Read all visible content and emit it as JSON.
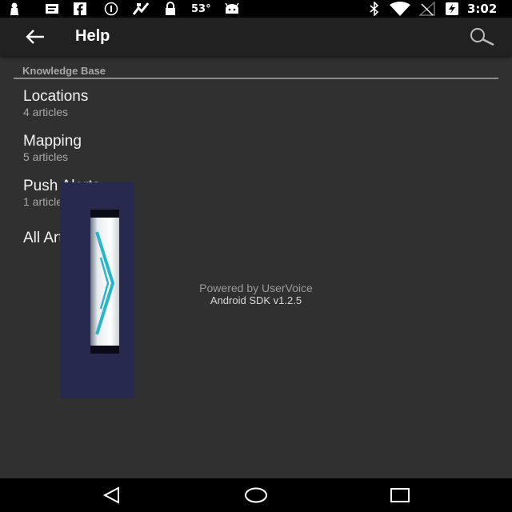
{
  "status_bar": {
    "temperature": "53°",
    "time": "3:02",
    "left_icons": [
      "person-icon",
      "message-icon",
      "facebook-icon",
      "info-icon",
      "satellite-icon",
      "lock-icon"
    ],
    "right_icons": [
      "bluetooth-icon",
      "wifi-icon",
      "signal-off-icon",
      "battery-charging-icon"
    ]
  },
  "app_bar": {
    "title": "Help",
    "back_icon": "arrow-back-icon",
    "search_icon": "search-icon"
  },
  "knowledge_base": {
    "header": "Knowledge Base",
    "topics": [
      {
        "title": "Locations",
        "subtitle": "4 articles"
      },
      {
        "title": "Mapping",
        "subtitle": "5 articles"
      },
      {
        "title": "Push Alerts",
        "subtitle": "1 article"
      },
      {
        "title": "All Articles",
        "subtitle": ""
      }
    ]
  },
  "footer": {
    "powered_by": "Powered by UserVoice",
    "sdk_version": "Android SDK v1.2.5"
  },
  "colors": {
    "background": "#303030",
    "app_bar": "#212121",
    "overlay": "#272a4e",
    "overlay_accent": "#29b6c8"
  },
  "nav_bar": {
    "icons": [
      "back-triangle-icon",
      "home-circle-icon",
      "recents-square-icon"
    ]
  }
}
